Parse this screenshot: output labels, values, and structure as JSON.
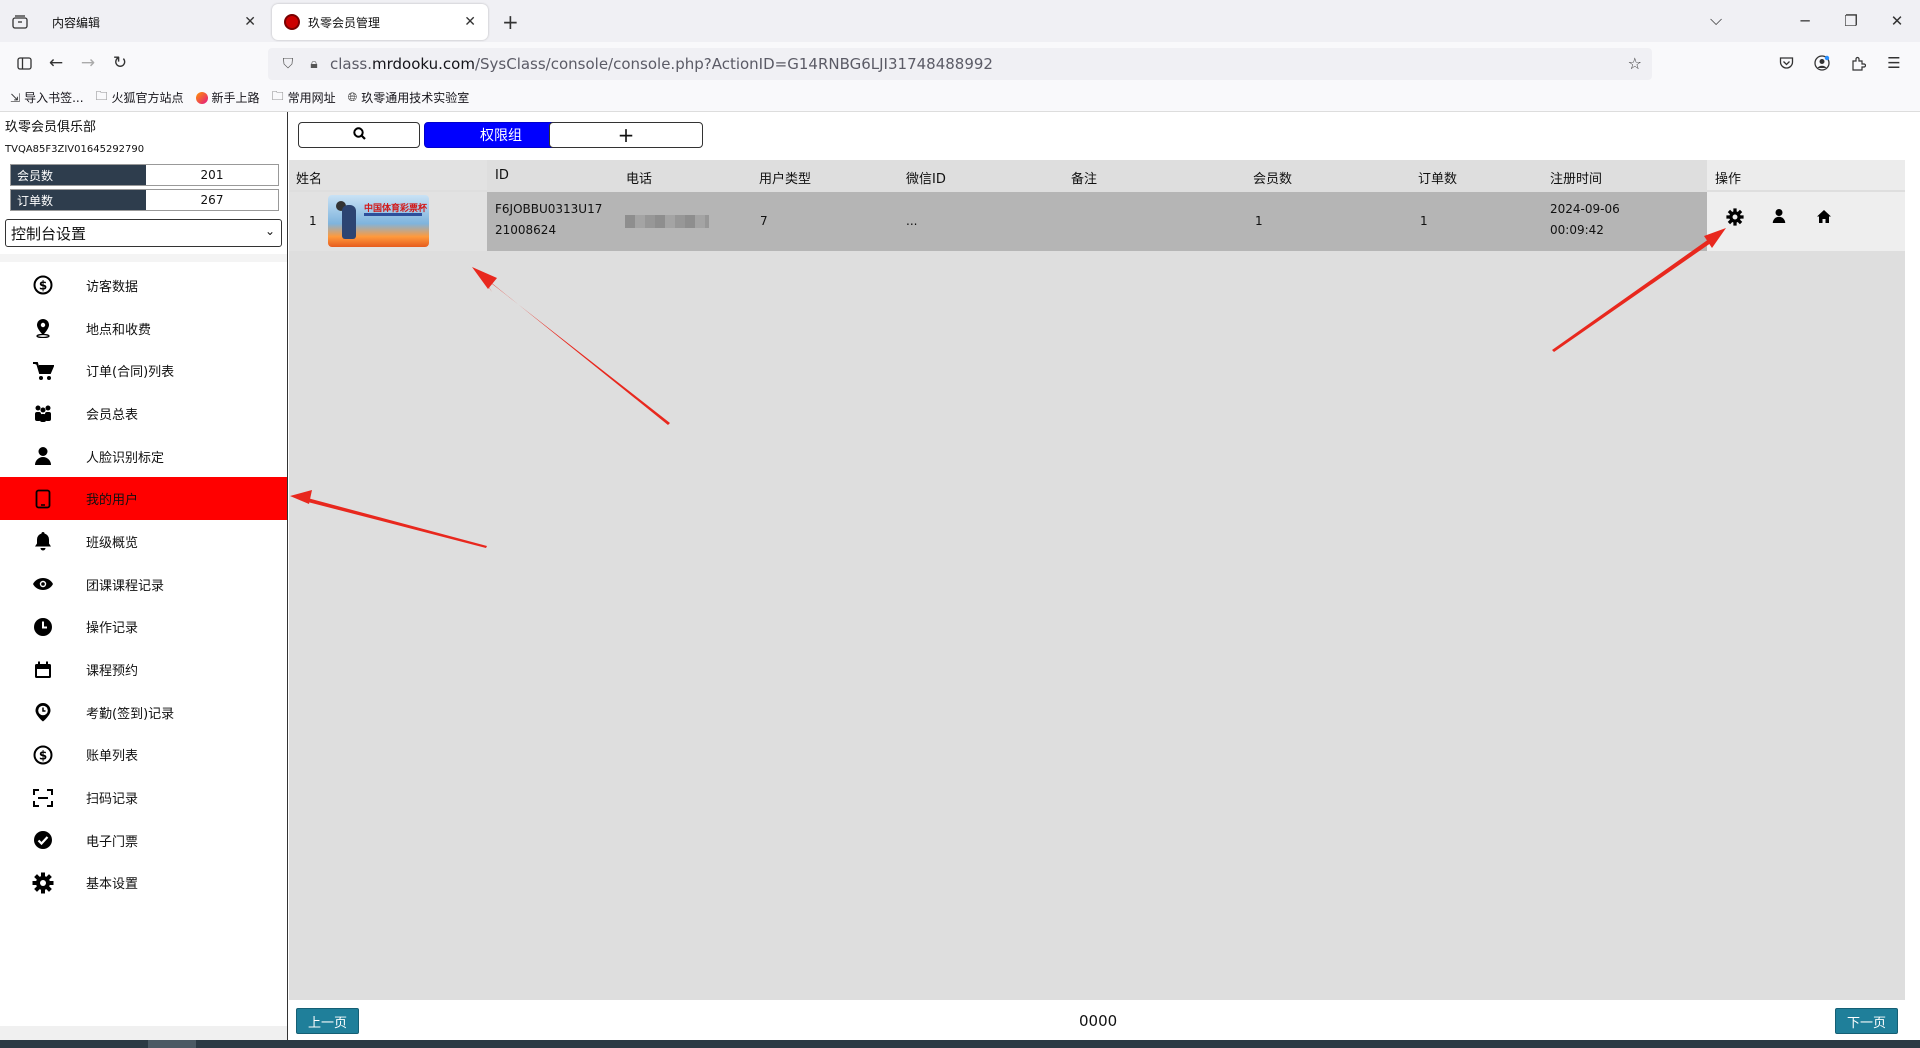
{
  "browser": {
    "tabs": [
      {
        "title": "内容编辑",
        "close": "✕"
      },
      {
        "title": "玖零会员管理",
        "close": "✕"
      }
    ],
    "new_tab": "+",
    "url_prefix": "class.",
    "url_host": "mrdooku.com",
    "url_path": "/SysClass/console/console.php?ActionID=G14RNBG6LJI31748488992",
    "bookmarks": [
      {
        "label": "导入书签...",
        "icon": "import-icon"
      },
      {
        "label": "火狐官方站点",
        "icon": "folder-icon"
      },
      {
        "label": "新手上路",
        "icon": "firefox-icon"
      },
      {
        "label": "常用网址",
        "icon": "folder-icon"
      },
      {
        "label": "玖零通用技术实验室",
        "icon": "globe-icon"
      }
    ]
  },
  "sidebar": {
    "org_name": "玖零会员俱乐部",
    "org_id": "TVQA85F3ZIV01645292790",
    "stats": [
      {
        "label": "会员数",
        "value": "201"
      },
      {
        "label": "订单数",
        "value": "267"
      }
    ],
    "console_select": "控制台设置",
    "menu": [
      {
        "label": "访客数据",
        "icon": "dollar-circle-icon"
      },
      {
        "label": "地点和收费",
        "icon": "map-pin-icon"
      },
      {
        "label": "订单(合同)列表",
        "icon": "cart-icon"
      },
      {
        "label": "会员总表",
        "icon": "people-icon"
      },
      {
        "label": "人脸识别标定",
        "icon": "user-icon"
      },
      {
        "label": "我的用户",
        "icon": "tablet-icon",
        "active": true
      },
      {
        "label": "班级概览",
        "icon": "bell-icon"
      },
      {
        "label": "团课课程记录",
        "icon": "eye-icon"
      },
      {
        "label": "操作记录",
        "icon": "clock-icon"
      },
      {
        "label": "课程预约",
        "icon": "calendar-icon"
      },
      {
        "label": "考勤(签到)记录",
        "icon": "location-clock-icon"
      },
      {
        "label": "账单列表",
        "icon": "dollar-circle-icon"
      },
      {
        "label": "扫码记录",
        "icon": "scan-icon"
      },
      {
        "label": "电子门票",
        "icon": "check-circle-icon"
      },
      {
        "label": "基本设置",
        "icon": "gear-icon"
      }
    ]
  },
  "toolbar": {
    "search_icon": "search-icon",
    "perm_group": "权限组",
    "add": "+"
  },
  "table": {
    "headers": [
      "姓名",
      "ID",
      "电话",
      "用户类型",
      "微信ID",
      "备注",
      "会员数",
      "订单数",
      "注册时间",
      "操作"
    ],
    "rows": [
      {
        "index": "1",
        "thumb_text": "中国体育彩票杯",
        "id_line1": "F6JOBBU0313U17",
        "id_line2": "21008624",
        "phone": "",
        "user_type": "7",
        "wechat_id": "...",
        "note": "",
        "member_count": "1",
        "order_count": "1",
        "reg_date": "2024-09-06",
        "reg_time": "00:09:42"
      }
    ]
  },
  "footer": {
    "prev": "上一页",
    "next": "下一页",
    "page": "0000"
  },
  "colors": {
    "active_menu": "#ff0000",
    "perm_button": "#0000ff",
    "pager_button": "#1f7f9a",
    "stat_label": "#2e3d4d",
    "row_bg": "#b5b5b5",
    "annotation_arrow": "#e8281e"
  }
}
